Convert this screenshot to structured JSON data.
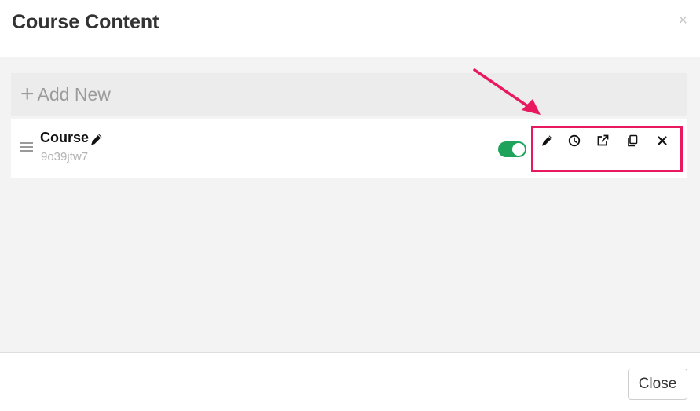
{
  "modal": {
    "title": "Course Content",
    "close_x": "×",
    "close_button": "Close"
  },
  "add_new": {
    "plus": "+",
    "label": "Add New"
  },
  "item": {
    "name": "Course",
    "id": "9o39jtw7",
    "enabled": true
  },
  "actions": [
    "pencil-icon",
    "clock-icon",
    "external-link-icon",
    "copy-icon",
    "close-icon"
  ],
  "colors": {
    "highlight": "#e8195e",
    "toggle_on": "#1fa35a",
    "body_bg": "#f3f3f3"
  }
}
